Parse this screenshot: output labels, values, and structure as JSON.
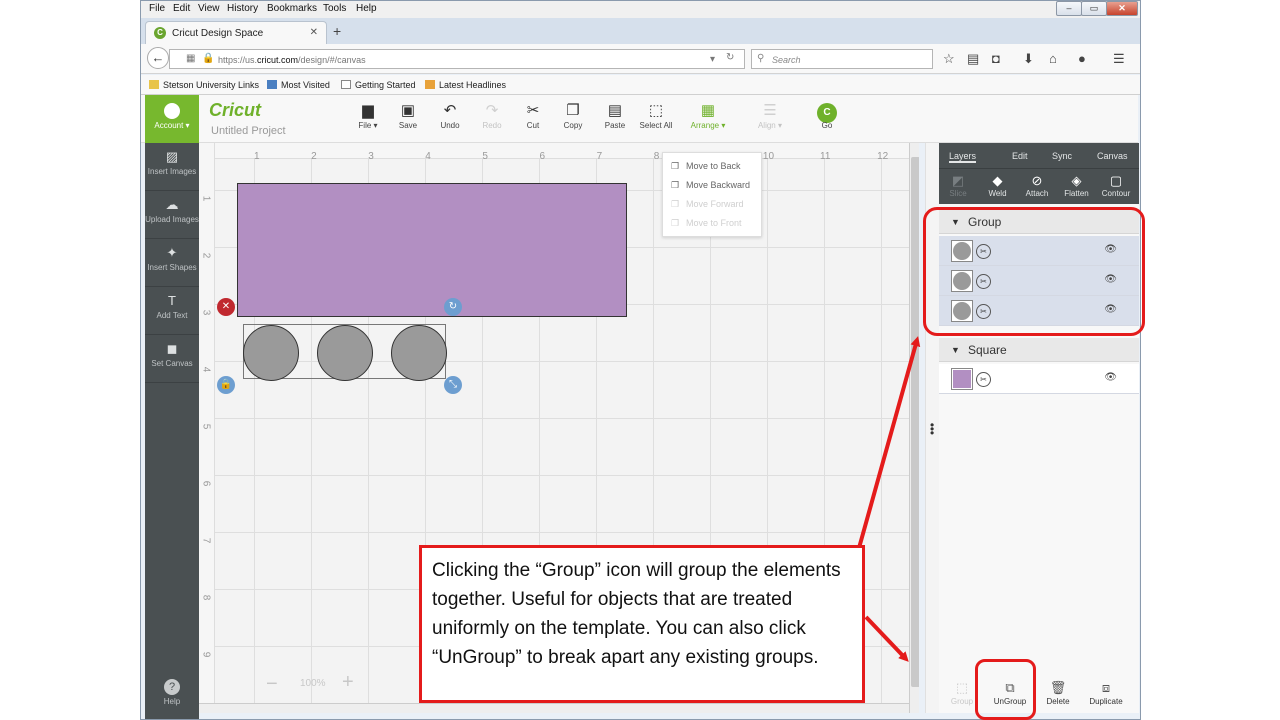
{
  "browser": {
    "menu": [
      "File",
      "Edit",
      "View",
      "History",
      "Bookmarks",
      "Tools",
      "Help"
    ],
    "tab_title": "Cricut Design Space",
    "url_prefix": "https://us.",
    "url_domain": "cricut.com",
    "url_path": "/design/#/canvas",
    "search_placeholder": "Search",
    "bookmarks": [
      "Stetson University Links",
      "Most Visited",
      "Getting Started",
      "Latest Headlines"
    ]
  },
  "app": {
    "account_label": "Account",
    "logo": "Cricut",
    "project_name": "Untitled Project",
    "toolbar": [
      {
        "label": "File",
        "icon": "folder-icon",
        "glyph": "▆",
        "disabled": false
      },
      {
        "label": "Save",
        "icon": "save-icon",
        "glyph": "▣",
        "disabled": false
      },
      {
        "label": "Undo",
        "icon": "undo-icon",
        "glyph": "↶",
        "disabled": false
      },
      {
        "label": "Redo",
        "icon": "redo-icon",
        "glyph": "↷",
        "disabled": true
      },
      {
        "label": "Cut",
        "icon": "cut-icon",
        "glyph": "✂",
        "disabled": false
      },
      {
        "label": "Copy",
        "icon": "copy-icon",
        "glyph": "❐",
        "disabled": false
      },
      {
        "label": "Paste",
        "icon": "paste-icon",
        "glyph": "▤",
        "disabled": false
      },
      {
        "label": "Select All",
        "icon": "select-all-icon",
        "glyph": "⬚",
        "disabled": false
      },
      {
        "label": "Arrange",
        "icon": "arrange-icon",
        "glyph": "▦",
        "disabled": false
      },
      {
        "label": "Align",
        "icon": "align-icon",
        "glyph": "☰",
        "disabled": true
      },
      {
        "label": "Go",
        "icon": "go-icon",
        "glyph": "C",
        "disabled": false
      }
    ],
    "sidebar": [
      {
        "label": "Insert Images",
        "icon": "image-icon",
        "glyph": "▨"
      },
      {
        "label": "Upload Images",
        "icon": "cloud-upload-icon",
        "glyph": "☁"
      },
      {
        "label": "Insert Shapes",
        "icon": "shapes-icon",
        "glyph": "✦"
      },
      {
        "label": "Add Text",
        "icon": "text-icon",
        "glyph": "T"
      },
      {
        "label": "Set Canvas",
        "icon": "shirt-icon",
        "glyph": "◼"
      }
    ],
    "help_label": "Help",
    "ruler_top": [
      "1",
      "2",
      "3",
      "4",
      "5",
      "6",
      "7",
      "8",
      "9",
      "10",
      "11",
      "12"
    ],
    "ruler_left": [
      "1",
      "2",
      "3",
      "4",
      "5",
      "6",
      "7",
      "8",
      "9"
    ],
    "zoom": "100%",
    "arrange_menu": [
      {
        "label": "Move to Back",
        "disabled": false
      },
      {
        "label": "Move Backward",
        "disabled": false
      },
      {
        "label": "Move Forward",
        "disabled": true
      },
      {
        "label": "Move to Front",
        "disabled": true
      }
    ],
    "panel_tabs": [
      "Layers",
      "Edit",
      "Sync",
      "Canvas"
    ],
    "panel_tools": [
      {
        "label": "Slice",
        "icon": "slice-icon",
        "glyph": "◩",
        "disabled": true
      },
      {
        "label": "Weld",
        "icon": "weld-icon",
        "glyph": "◆",
        "disabled": false
      },
      {
        "label": "Attach",
        "icon": "attach-icon",
        "glyph": "⊘",
        "disabled": false
      },
      {
        "label": "Flatten",
        "icon": "flatten-icon",
        "glyph": "◈",
        "disabled": false
      },
      {
        "label": "Contour",
        "icon": "contour-icon",
        "glyph": "▢",
        "disabled": false
      }
    ],
    "layers": {
      "group_title": "Group",
      "group_count": 3,
      "square_title": "Square"
    },
    "bottom_tools": [
      {
        "label": "Group",
        "icon": "group-icon",
        "glyph": "⬚",
        "disabled": true
      },
      {
        "label": "UnGroup",
        "icon": "ungroup-icon",
        "glyph": "⧉",
        "disabled": false
      },
      {
        "label": "Delete",
        "icon": "trash-icon",
        "glyph": "🗑",
        "disabled": false
      },
      {
        "label": "Duplicate",
        "icon": "duplicate-icon",
        "glyph": "⧈",
        "disabled": false
      }
    ],
    "colors": {
      "accent": "#6fb12b",
      "rect_fill": "#b28fc2",
      "circle_fill": "#9a9a9a",
      "annotation": "#e41b1b"
    }
  },
  "annotation": {
    "callout_text": "Clicking the “Group” icon will group the elements together. Useful for objects that are treated uniformly on the template. You can also click “UnGroup” to break apart any existing groups."
  }
}
